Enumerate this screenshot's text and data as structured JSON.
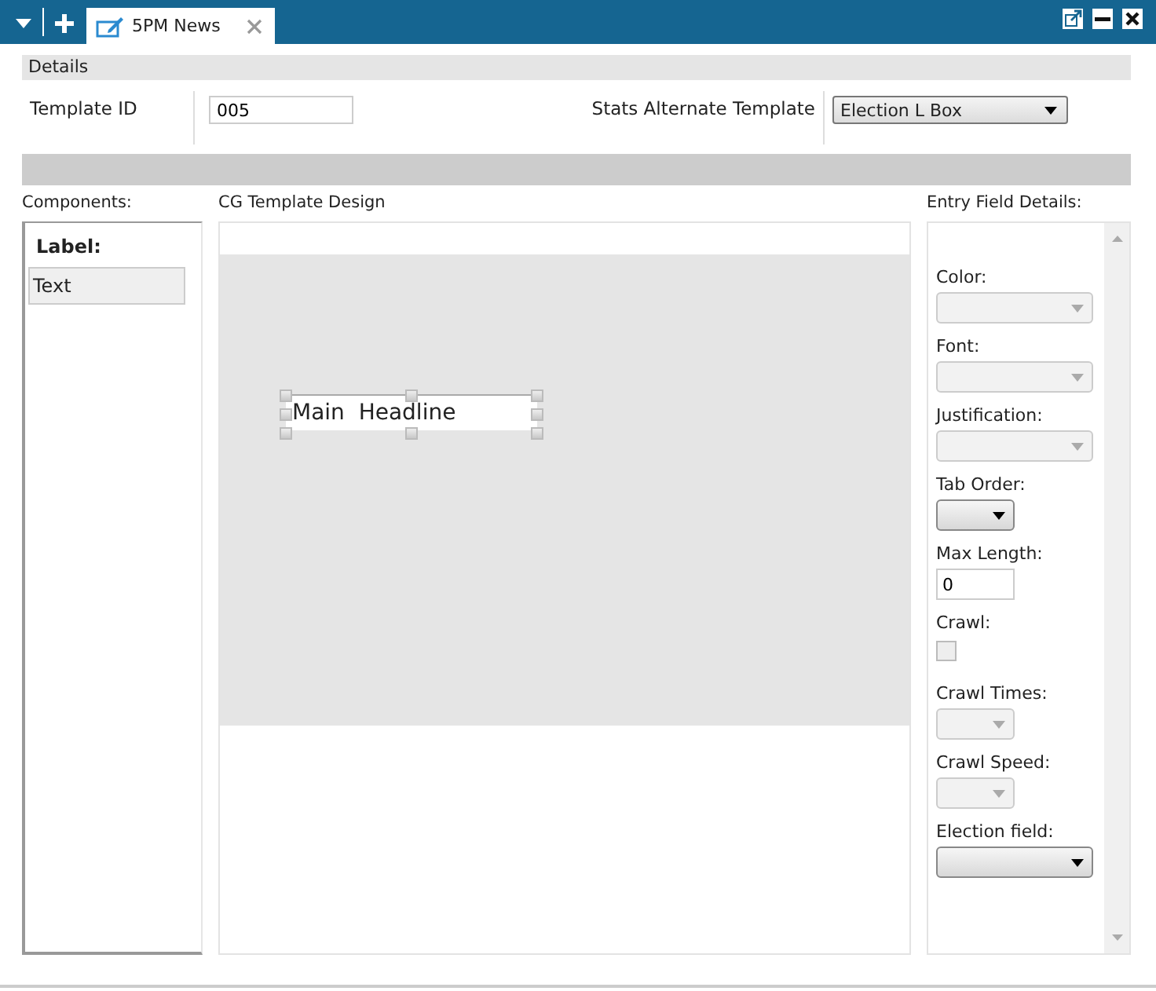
{
  "tabs": [
    {
      "label": "5PM News",
      "selected": true
    }
  ],
  "details": {
    "title": "Details",
    "template_id_label": "Template ID",
    "template_id": "005",
    "alt_label": "Stats Alternate Template",
    "alt_value": "Election L Box"
  },
  "components": {
    "title": "Components:",
    "header": "Label:",
    "items": [
      {
        "label": "Text",
        "selected": true
      }
    ]
  },
  "design": {
    "title": "CG Template Design",
    "element": {
      "text": "Main  Headline",
      "selected": true
    }
  },
  "entry": {
    "title": "Entry Field Details:",
    "fields": [
      {
        "label": "Color:",
        "kind": "dropdown",
        "disabled": true
      },
      {
        "label": "Font:",
        "kind": "dropdown",
        "disabled": true
      },
      {
        "label": "Justification:",
        "kind": "dropdown",
        "disabled": true
      },
      {
        "label": "Tab Order:",
        "kind": "smalldropdown",
        "disabled": false
      },
      {
        "label": "Max Length:",
        "kind": "text",
        "value": "0"
      },
      {
        "label": "Crawl:",
        "kind": "checkbox",
        "checked": false,
        "disabled": true
      },
      {
        "label": "Crawl Times:",
        "kind": "smalldropdown",
        "disabled": true
      },
      {
        "label": "Crawl Speed:",
        "kind": "smalldropdown",
        "disabled": true
      },
      {
        "label": "Election field:",
        "kind": "dropdown",
        "disabled": false
      }
    ]
  }
}
